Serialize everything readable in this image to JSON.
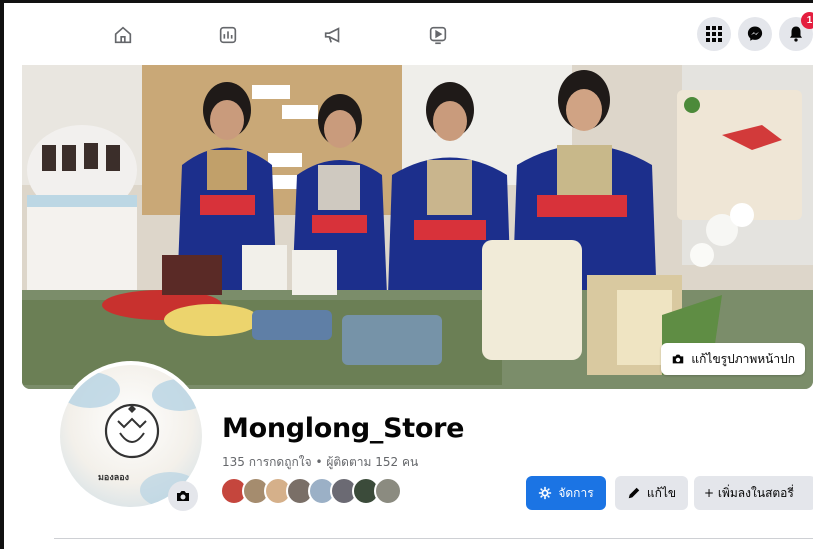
{
  "nav": {
    "icons": [
      "home-icon",
      "pages-icon",
      "megaphone-icon",
      "video-icon"
    ],
    "right": [
      "menu-grid-icon",
      "messenger-icon",
      "bell-icon"
    ],
    "notification_count": "1"
  },
  "cover": {
    "edit_label": "แก้ไขรูปภาพหน้าปก"
  },
  "profile": {
    "name": "Monglong_Store",
    "stats": "135 การกดถูกใจ • ผู้ติดตาม 152 คน",
    "logo_text": "มองลอง"
  },
  "actions": {
    "manage_label": "จัดการ",
    "edit_label": "แก้ไข",
    "add_label": "+ เพิ่มลงในสตอรี่"
  },
  "colors": {
    "primary": "#1b74e4",
    "secondary_bg": "#e4e6eb",
    "badge": "#e41e3f",
    "muted_text": "#65676b"
  }
}
